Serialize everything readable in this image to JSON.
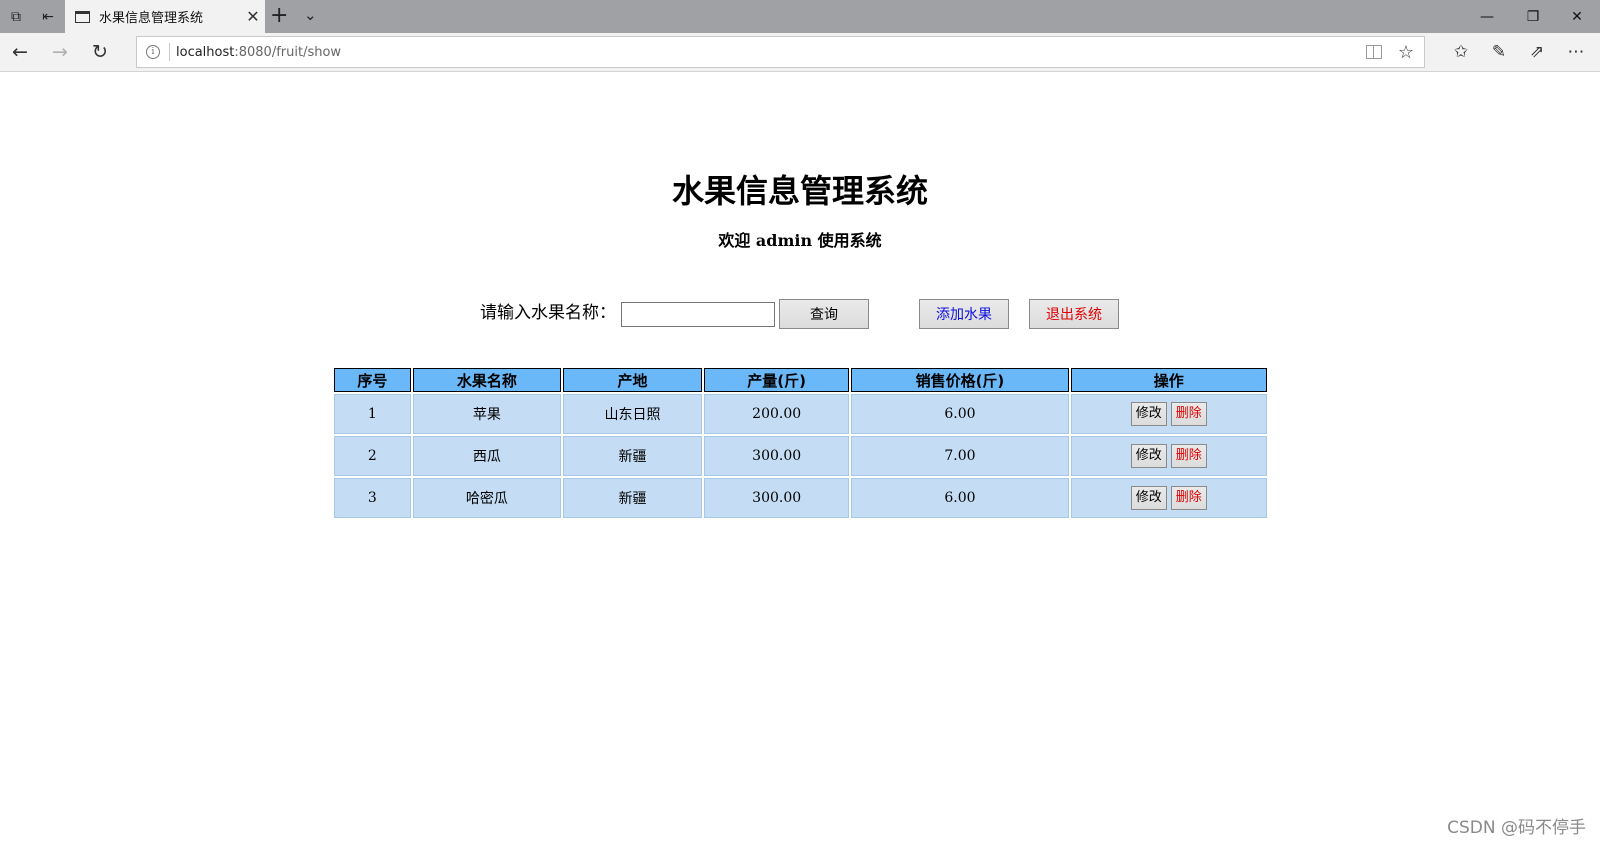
{
  "browser": {
    "tab_title": "水果信息管理系统",
    "url_host": "localhost",
    "url_rest": ":8080/fruit/show"
  },
  "page": {
    "title": "水果信息管理系统",
    "welcome": "欢迎 admin 使用系统",
    "search_label": "请输入水果名称：",
    "search_value": "",
    "query_label": "查询",
    "add_label": "添加水果",
    "logout_label": "退出系统"
  },
  "table": {
    "headers": [
      "序号",
      "水果名称",
      "产地",
      "产量(斤)",
      "销售价格(斤)",
      "操作"
    ],
    "rows": [
      {
        "id": "1",
        "name": "苹果",
        "origin": "山东日照",
        "yield": "200.00",
        "price": "6.00"
      },
      {
        "id": "2",
        "name": "西瓜",
        "origin": "新疆",
        "yield": "300.00",
        "price": "7.00"
      },
      {
        "id": "3",
        "name": "哈密瓜",
        "origin": "新疆",
        "yield": "300.00",
        "price": "6.00"
      }
    ],
    "edit_label": "修改",
    "delete_label": "删除"
  },
  "watermark": "CSDN @码不停手",
  "colors": {
    "header_bg": "#6ab8f8",
    "cell_bg": "#c5ddf4",
    "add_text": "#1010e0",
    "danger_text": "#e00000"
  }
}
